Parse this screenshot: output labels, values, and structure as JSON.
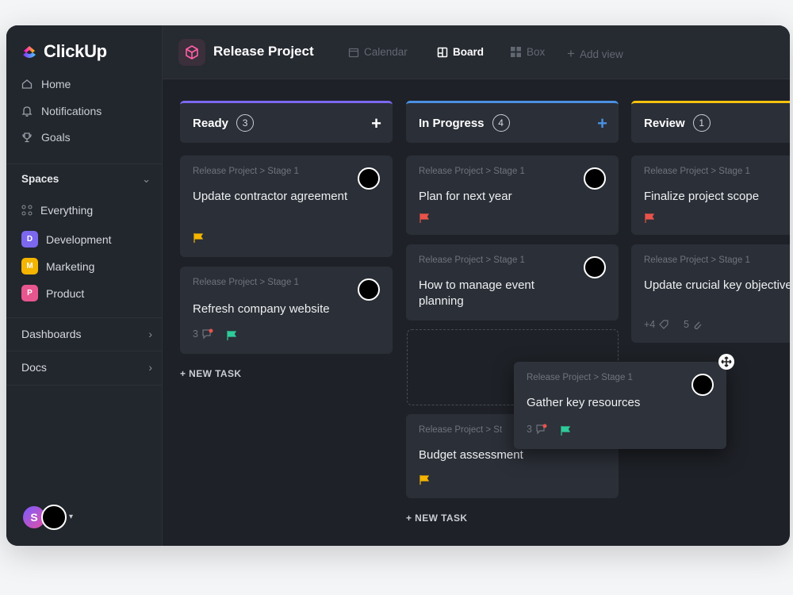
{
  "brand": {
    "name": "ClickUp"
  },
  "sidebar": {
    "nav": [
      {
        "label": "Home",
        "icon": "home-icon"
      },
      {
        "label": "Notifications",
        "icon": "bell-icon"
      },
      {
        "label": "Goals",
        "icon": "trophy-icon"
      }
    ],
    "spaces_label": "Spaces",
    "everything_label": "Everything",
    "spaces": [
      {
        "letter": "D",
        "label": "Development",
        "color": "#7b68ee"
      },
      {
        "letter": "M",
        "label": "Marketing",
        "color": "#f4b400"
      },
      {
        "letter": "P",
        "label": "Product",
        "color": "#e8568f"
      }
    ],
    "dashboards_label": "Dashboards",
    "docs_label": "Docs",
    "user_initial": "S"
  },
  "topbar": {
    "project_title": "Release Project",
    "views": [
      {
        "label": "Calendar",
        "icon": "calendar-icon",
        "active": false
      },
      {
        "label": "Board",
        "icon": "board-icon",
        "active": true
      },
      {
        "label": "Box",
        "icon": "box-icon",
        "active": false
      },
      {
        "label": "Add view",
        "icon": "plus-icon",
        "active": false
      }
    ]
  },
  "columns": [
    {
      "title": "Ready",
      "count": "3",
      "color": "#7b68ee",
      "plus_color": "#ffffff"
    },
    {
      "title": "In Progress",
      "count": "4",
      "color": "#4a90e2",
      "plus_color": "#4a90e2"
    },
    {
      "title": "Review",
      "count": "1",
      "color": "#f4c20d",
      "plus_color": "#f4c20d"
    }
  ],
  "cards": {
    "ready": [
      {
        "crumb": "Release Project > Stage 1",
        "title": "Update contractor agreement",
        "flag": "#f4b400"
      },
      {
        "crumb": "Release Project > Stage 1",
        "title": "Refresh company website",
        "comments": "3",
        "flag": "#2ecc9a"
      }
    ],
    "in_progress": [
      {
        "crumb": "Release Project > Stage 1",
        "title": "Plan for next year",
        "flag": "#e9534a"
      },
      {
        "crumb": "Release Project > Stage 1",
        "title": "How to manage event planning"
      },
      {
        "crumb": "Release Project > St",
        "title": "Budget assessment",
        "flag": "#f4b400"
      }
    ],
    "review": [
      {
        "crumb": "Release Project > Stage 1",
        "title": "Finalize project scope",
        "flag": "#e9534a"
      },
      {
        "crumb": "Release Project > Stage 1",
        "title": "Update crucial key objectives",
        "extra": "+4",
        "attachments": "5"
      }
    ],
    "dragging": {
      "crumb": "Release Project > Stage 1",
      "title": "Gather key resources",
      "comments": "3",
      "flag": "#2ecc9a"
    }
  },
  "new_task_label": "+ NEW TASK"
}
